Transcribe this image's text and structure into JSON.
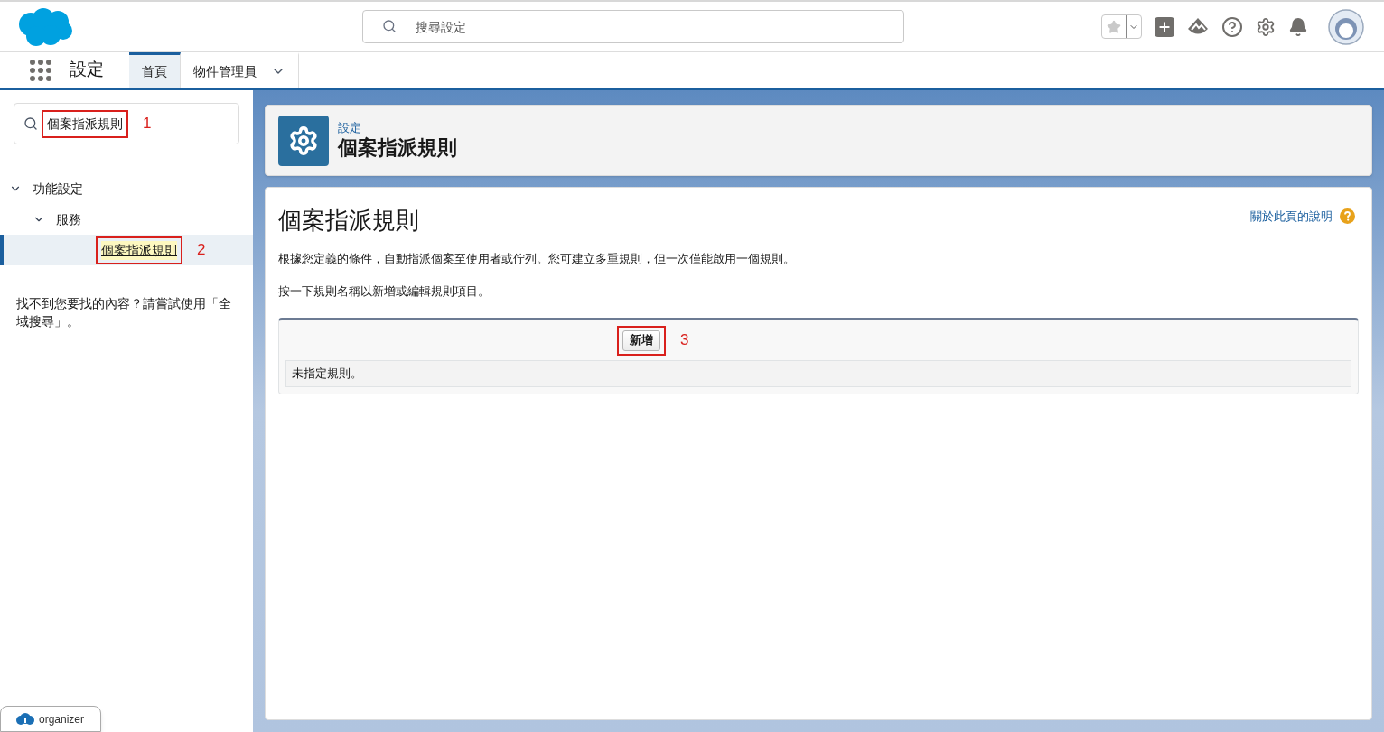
{
  "header": {
    "search": {
      "placeholder": "搜尋設定"
    }
  },
  "nav": {
    "app_name": "設定",
    "tabs": [
      {
        "label": "首頁",
        "selected": true,
        "has_menu": false
      },
      {
        "label": "物件管理員",
        "selected": false,
        "has_menu": true
      }
    ]
  },
  "sidebar": {
    "quick_find": {
      "value": "個案指派規則",
      "annotation": "1"
    },
    "tree": [
      {
        "label": "功能設定",
        "expanded": true,
        "children": [
          {
            "label": "服務",
            "expanded": true,
            "children": [
              {
                "label": "個案指派規則",
                "selected": true,
                "annotation": "2"
              }
            ]
          }
        ]
      }
    ],
    "hint": "找不到您要找的內容？請嘗試使用「全域搜尋」。"
  },
  "page_header": {
    "breadcrumb": "設定",
    "title": "個案指派規則"
  },
  "content": {
    "title": "個案指派規則",
    "help_link": "關於此頁的說明",
    "paragraphs": [
      "根據您定義的條件，自動指派個案至使用者或佇列。您可建立多重規則，但一次僅能啟用一個規則。",
      "按一下規則名稱以新增或編輯規則項目。"
    ],
    "new_button": {
      "label": "新增",
      "annotation": "3"
    },
    "empty_message": "未指定規則。"
  },
  "footer": {
    "organizer": "organizer"
  }
}
